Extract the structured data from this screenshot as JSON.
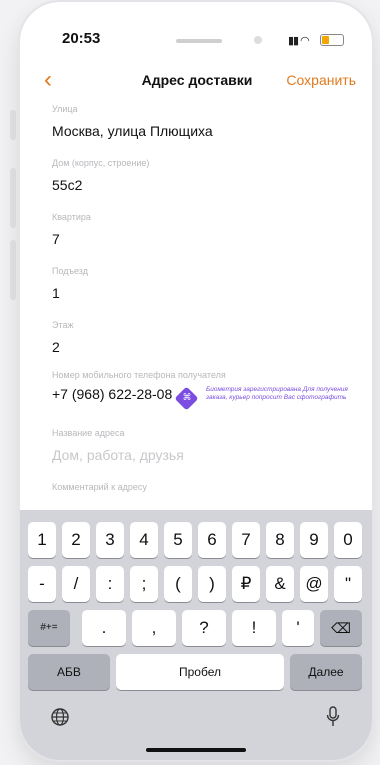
{
  "status": {
    "time": "20:53"
  },
  "navbar": {
    "title": "Адрес доставки",
    "save_label": "Сохранить"
  },
  "fields": [
    {
      "label": "Улица",
      "value": "Москва, улица Плющиха"
    },
    {
      "label": "Дом (корпус, строение)",
      "value": "55с2"
    },
    {
      "label": "Квартира",
      "value": "7"
    },
    {
      "label": "Подъезд",
      "value": "1"
    },
    {
      "label": "Этаж",
      "value": "2"
    },
    {
      "label": "Номер мобильного телефона получателя",
      "value": "+7 (968) 622-28-08"
    },
    {
      "label": "Название адреса",
      "placeholder": "Дом, работа, друзья"
    },
    {
      "label": "Комментарий к адресу",
      "value": ""
    }
  ],
  "biometrics": {
    "text": "Биометрия зарегистрирована Для получения заказа, курьер попросит Вас сфотографить"
  },
  "keyboard": {
    "row1": [
      "1",
      "2",
      "3",
      "4",
      "5",
      "6",
      "7",
      "8",
      "9",
      "0"
    ],
    "row2": [
      "-",
      "/",
      ":",
      ";",
      "(",
      ")",
      "₽",
      "&",
      "@",
      "\""
    ],
    "row3_mode": "#+=",
    "row3": [
      ".",
      ",",
      "?",
      "!",
      "'"
    ],
    "backspace": "⌫",
    "abc": "АБВ",
    "space": "Пробел",
    "next": "Далее"
  },
  "colors": {
    "accent": "#e07a1f",
    "bio": "#7b4de0"
  }
}
